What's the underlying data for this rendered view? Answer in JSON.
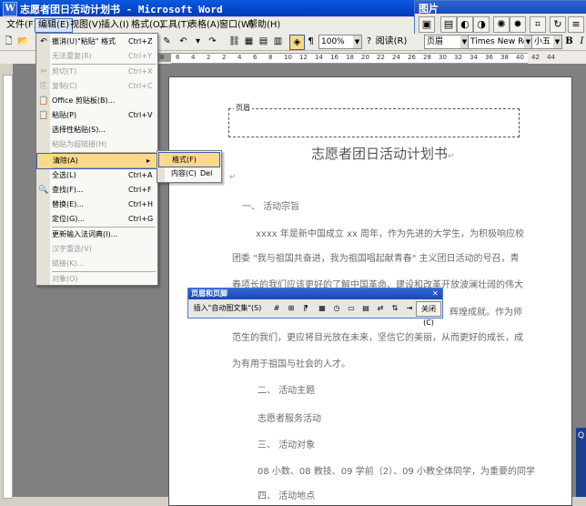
{
  "window": {
    "title": "志愿者团日活动计划书 - Microsoft Word",
    "app_icon": "W"
  },
  "picture_toolbar": {
    "title": "图片"
  },
  "menubar": {
    "items": [
      "文件(F)",
      "编辑(E)",
      "视图(V)",
      "插入(I)",
      "格式(O)",
      "工具(T)",
      "表格(A)",
      "窗口(W)",
      "帮助(H)"
    ]
  },
  "toolbar": {
    "zoom": "100%",
    "read_label": "阅读(R)",
    "style": "页眉",
    "font": "Times New Roman",
    "size": "小五",
    "bold": "B",
    "italic": "I"
  },
  "ruler": {
    "ticks": [
      "8",
      "6",
      "4",
      "2",
      "2",
      "4",
      "6",
      "8",
      "10",
      "12",
      "14",
      "16",
      "18",
      "20",
      "22",
      "24",
      "26",
      "28",
      "30",
      "32",
      "34",
      "36",
      "38",
      "40",
      "42",
      "44"
    ]
  },
  "edit_menu": {
    "items": [
      {
        "label": "撤消(U)\"粘贴\" 格式",
        "shortcut": "Ctrl+Z",
        "disabled": false,
        "icon": "undo-icon"
      },
      {
        "label": "无法重复(R)",
        "shortcut": "Ctrl+Y",
        "disabled": true,
        "icon": ""
      },
      {
        "label": "剪切(T)",
        "shortcut": "Ctrl+X",
        "disabled": true,
        "icon": "cut-icon"
      },
      {
        "label": "复制(C)",
        "shortcut": "Ctrl+C",
        "disabled": true,
        "icon": "copy-icon"
      },
      {
        "label": "Office 剪贴板(B)...",
        "shortcut": "",
        "disabled": false,
        "icon": "clipboard-icon"
      },
      {
        "label": "粘贴(P)",
        "shortcut": "Ctrl+V",
        "disabled": false,
        "icon": "paste-icon"
      },
      {
        "label": "选择性粘贴(S)...",
        "shortcut": "",
        "disabled": false,
        "icon": ""
      },
      {
        "label": "粘贴为超链接(H)",
        "shortcut": "",
        "disabled": true,
        "icon": ""
      },
      {
        "label": "清除(A)",
        "shortcut": "",
        "disabled": false,
        "icon": "",
        "submenu": true
      },
      {
        "label": "全选(L)",
        "shortcut": "Ctrl+A",
        "disabled": false,
        "icon": ""
      },
      {
        "label": "查找(F)...",
        "shortcut": "Ctrl+F",
        "disabled": false,
        "icon": "find-icon"
      },
      {
        "label": "替换(E)...",
        "shortcut": "Ctrl+H",
        "disabled": false,
        "icon": ""
      },
      {
        "label": "定位(G)...",
        "shortcut": "Ctrl+G",
        "disabled": false,
        "icon": ""
      },
      {
        "label": "更新输入法词典(I)...",
        "shortcut": "",
        "disabled": false,
        "icon": ""
      },
      {
        "label": "汉字重选(V)",
        "shortcut": "",
        "disabled": true,
        "icon": ""
      },
      {
        "label": "链接(K)...",
        "shortcut": "",
        "disabled": true,
        "icon": ""
      },
      {
        "label": "对象(O)",
        "shortcut": "",
        "disabled": true,
        "icon": ""
      }
    ]
  },
  "clear_submenu": {
    "items": [
      {
        "label": "格式(F)",
        "shortcut": ""
      },
      {
        "label": "内容(C)",
        "shortcut": "Del"
      }
    ]
  },
  "hf_toolbar": {
    "title": "页眉和页脚",
    "insert_autotext": "插入\"自动图文集\"(S)",
    "close": "关闭(C)"
  },
  "document": {
    "header_label": "页眉",
    "title": "志愿者团日活动计划书",
    "lines": [
      "一、 活动宗旨",
      "xxxx 年是新中国成立 xx 周年，作为先进的大学生，为积极响应校",
      "团委 \"我与祖国共奋进，我为祖国唱起献青春\" 主义团日活动的号召，青",
      "春项长的我们应该更好的了解中国革命、建设和改革开放波澜壮阔的伟大",
      "辉煌成就。作为师",
      "范生的我们，更应将目光放在未来，坚信它的美丽，从而更好的成长，成",
      "为有用于祖国与社会的人才。",
      "二、 活动主题",
      "志愿者服务活动",
      "三、 活动对象",
      "08 小数、08 教技、09 学前（2）、09 小教全体同学，为重要的同学",
      "四、 活动地点"
    ]
  },
  "corner_text": "Q"
}
